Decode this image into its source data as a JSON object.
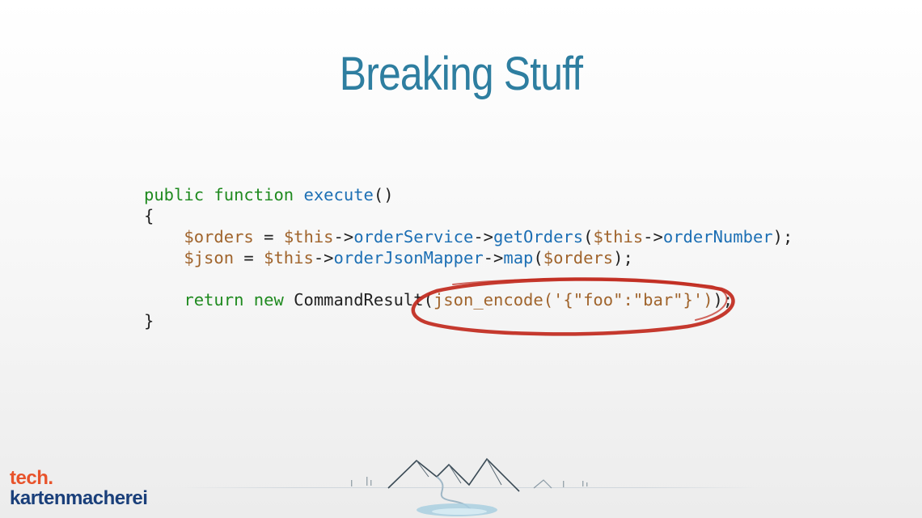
{
  "slide": {
    "title": "Breaking Stuff"
  },
  "code": {
    "line1": {
      "kw1": "public",
      "kw2": "function",
      "fn": "execute",
      "rest": "()"
    },
    "line2": {
      "text": "{"
    },
    "line3": {
      "v1": "$orders",
      "op1": " = ",
      "v2": "$this",
      "a1": "->",
      "f1": "orderService",
      "a2": "->",
      "f2": "getOrders",
      "p1": "(",
      "v3": "$this",
      "a3": "->",
      "f3": "orderNumber",
      "end": ");"
    },
    "line4": {
      "v1": "$json",
      "op1": " = ",
      "v2": "$this",
      "a1": "->",
      "f1": "orderJsonMapper",
      "a2": "->",
      "f2": "map",
      "p1": "(",
      "v3": "$orders",
      "end": ");"
    },
    "line6": {
      "kw1": "return",
      "kw2": "new",
      "cls": "CommandResult",
      "p1": "(",
      "str": "json_encode('{\"foo\":\"bar\"}')",
      "end": ");"
    },
    "line7": {
      "text": "}"
    }
  },
  "logo": {
    "line1": "tech.",
    "line2": "kartenmacherei"
  },
  "colors": {
    "title": "#2e7ea0",
    "keyword": "#1f8a1f",
    "function": "#1c6fb4",
    "variable": "#a0642c",
    "highlight_circle": "#c0281c",
    "logo_accent": "#e8532b",
    "logo_primary": "#1a3f7a"
  }
}
